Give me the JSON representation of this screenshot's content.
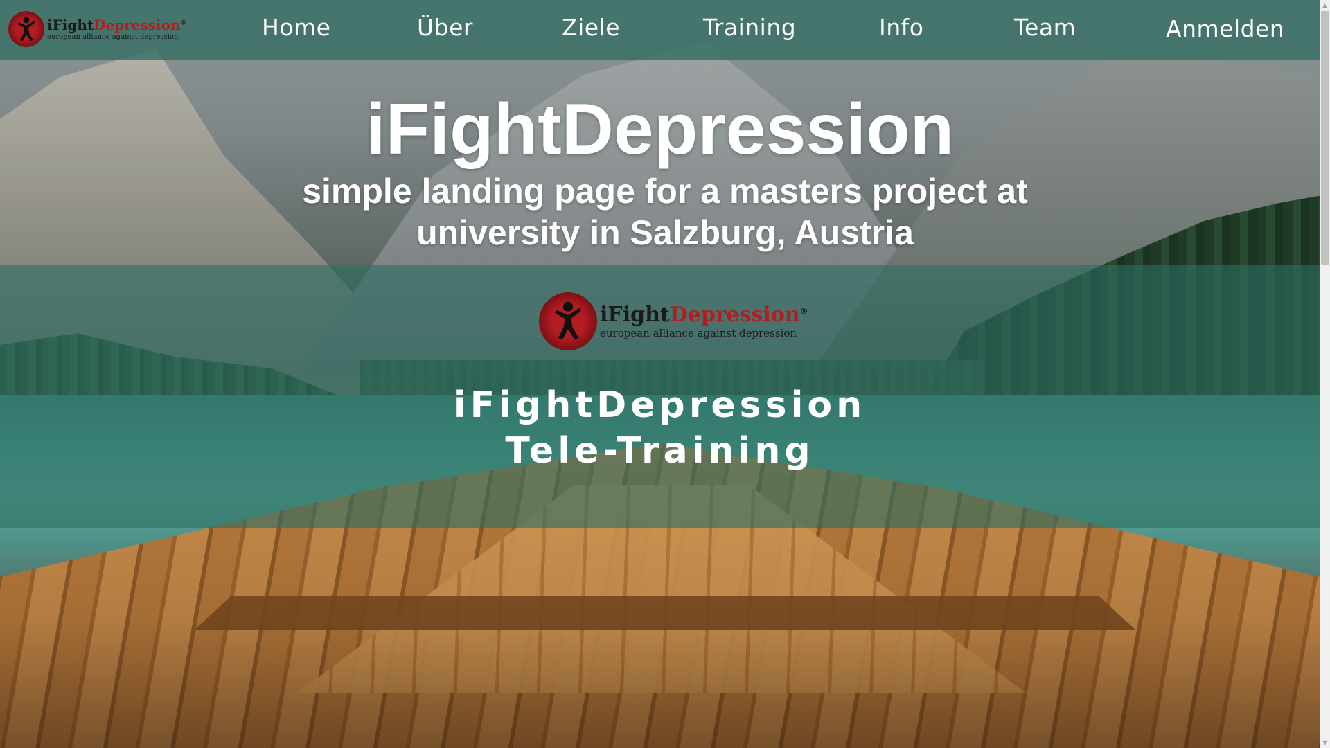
{
  "nav": {
    "logo": {
      "title_black": "iFight",
      "title_red": "Depression",
      "registered": "®",
      "tagline": "european alliance against depression"
    },
    "items": [
      {
        "label": "Home"
      },
      {
        "label": "Über"
      },
      {
        "label": "Ziele"
      },
      {
        "label": "Training"
      },
      {
        "label": "Info"
      },
      {
        "label": "Team"
      },
      {
        "label": "Anmelden"
      }
    ]
  },
  "hero": {
    "title": "iFightDepression",
    "subtitle": "simple landing page for a masters project at university in Salzburg, Austria"
  },
  "band": {
    "logo": {
      "title_black": "iFight",
      "title_red": "Depression",
      "registered": "®",
      "tagline": "european alliance against depression"
    },
    "title_line1": "iFightDepression",
    "title_line2": "Tele-Training"
  },
  "colors": {
    "nav_background": "#366e64",
    "band_background": "#2d6e62",
    "logo_red": "#b21d22",
    "text": "#ffffff"
  },
  "icons": {
    "logo": "person-silhouette-on-red-circle-icon",
    "scroll_up": "chevron-up-icon",
    "scroll_down": "chevron-down-icon"
  }
}
